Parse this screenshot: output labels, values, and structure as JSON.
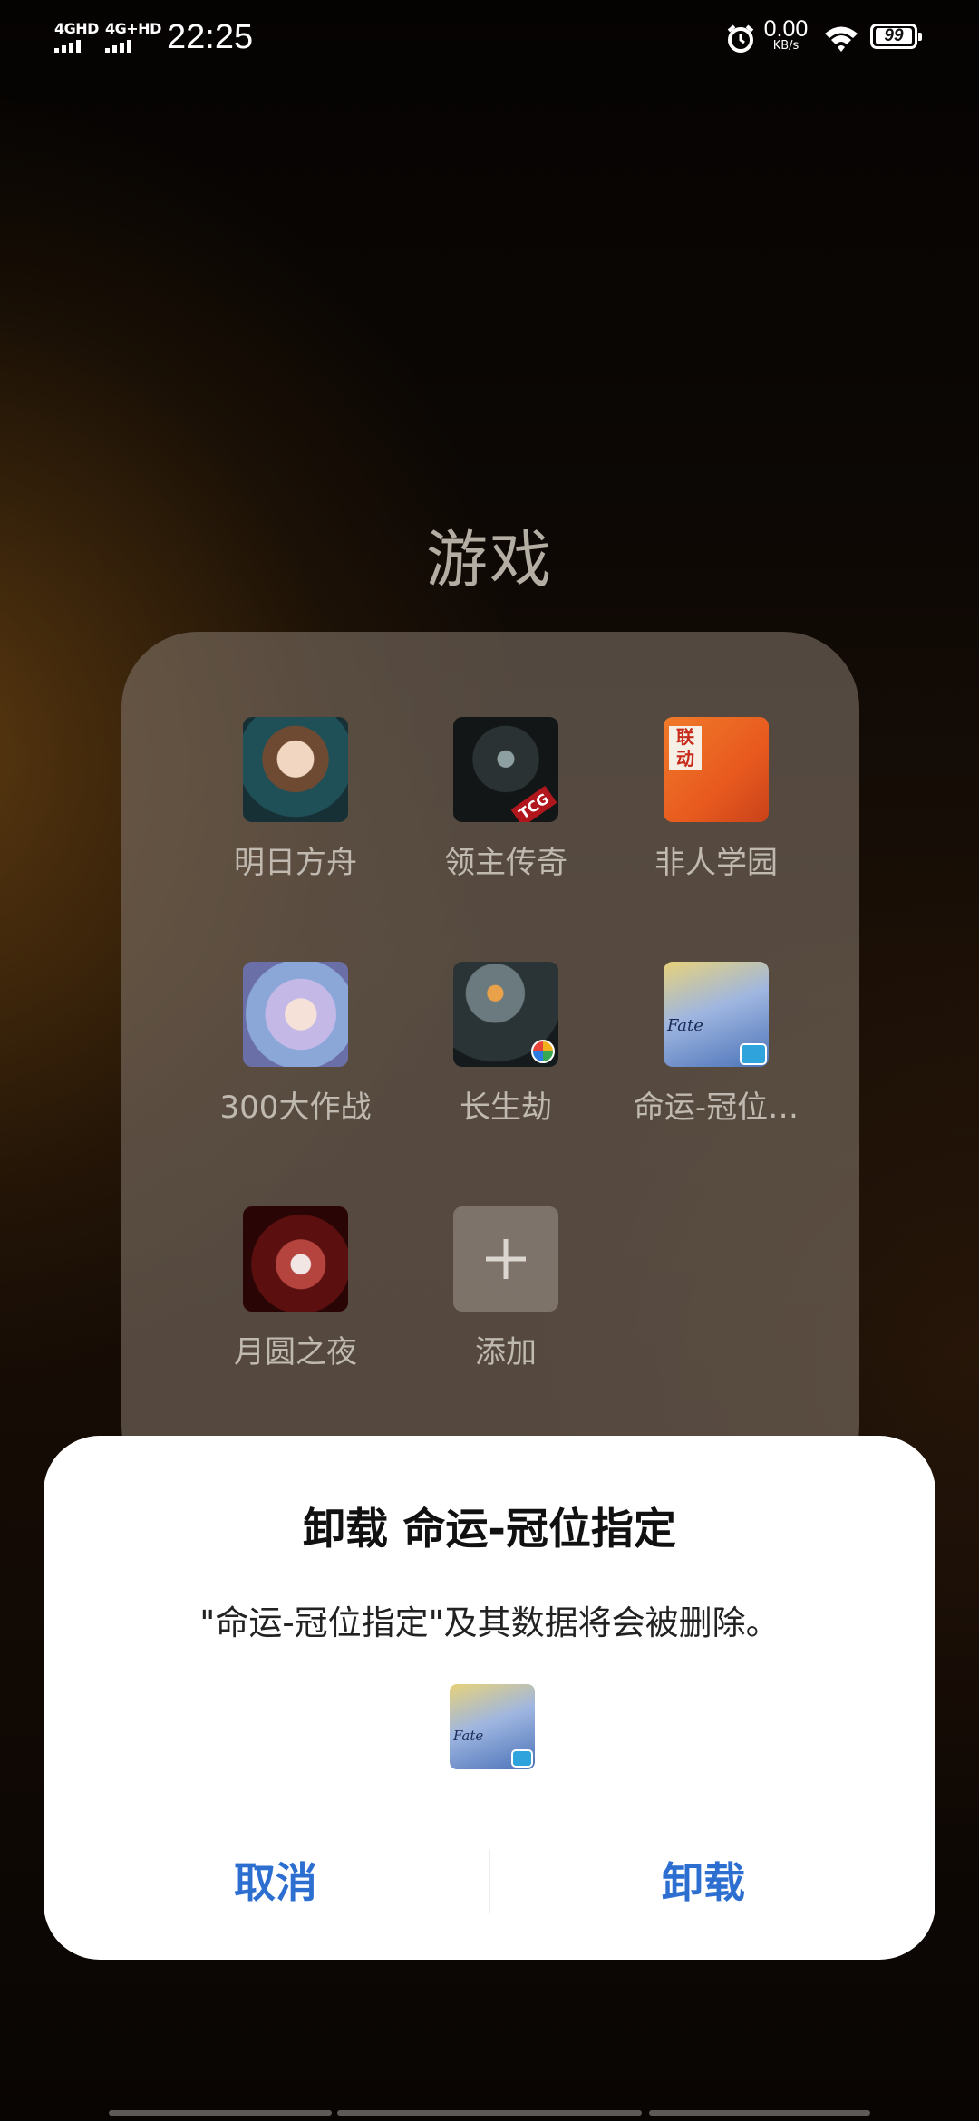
{
  "status_bar": {
    "sim1": "4GHD",
    "sim2": "4G+HD",
    "time": "22:25",
    "net_speed": "0.00",
    "net_speed_unit": "KB/s",
    "battery_level": "99"
  },
  "folder": {
    "title": "游戏",
    "apps": [
      {
        "label": "明日方舟",
        "icon": "arknights-icon"
      },
      {
        "label": "领主传奇",
        "icon": "lord-legend-icon"
      },
      {
        "label": "非人学园",
        "icon": "feiren-academy-icon"
      },
      {
        "label": "300大作战",
        "icon": "300-battle-icon"
      },
      {
        "label": "长生劫",
        "icon": "changshengjie-icon"
      },
      {
        "label": "命运-冠位…",
        "icon": "fate-grand-order-icon"
      },
      {
        "label": "月圆之夜",
        "icon": "full-moon-night-icon"
      },
      {
        "label": "添加",
        "icon": "add-icon"
      }
    ],
    "badges": {
      "tcg": "TCG",
      "lian": "联\n动",
      "fate": "Fate"
    }
  },
  "dialog": {
    "title": "卸载 命运-冠位指定",
    "message": "\"命运-冠位指定\"及其数据将会被删除。",
    "cancel_label": "取消",
    "confirm_label": "卸载",
    "accent_color": "#2d6fd1"
  }
}
